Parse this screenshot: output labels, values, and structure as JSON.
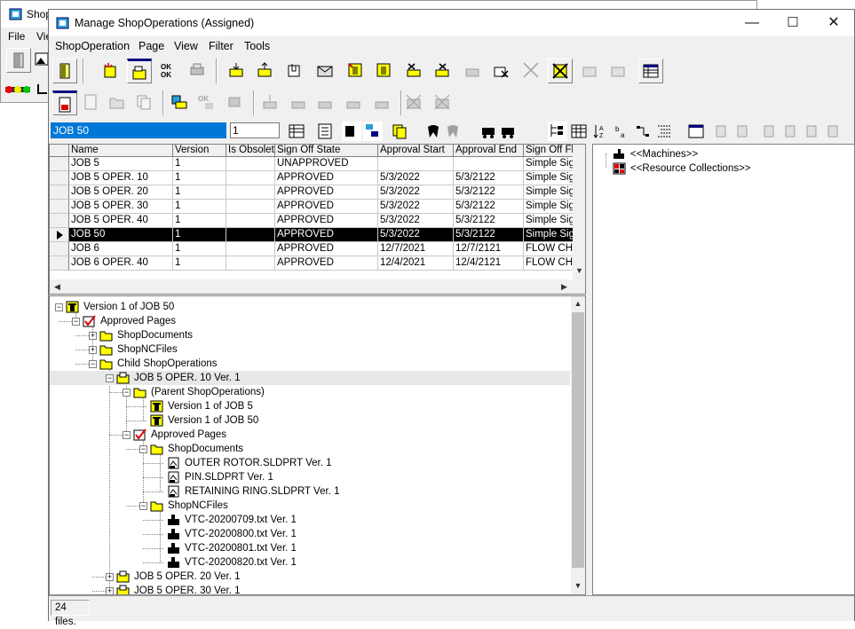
{
  "bg_window": {
    "title": "Shop",
    "menu": [
      "File",
      "Vie"
    ]
  },
  "window": {
    "title": "Manage ShopOperations (Assigned)",
    "minimize": "—",
    "maximize": "☐",
    "close": "✕"
  },
  "menu": [
    "ShopOperation",
    "Page",
    "View",
    "Filter",
    "Tools"
  ],
  "search": {
    "name_value": "JOB 50",
    "version_value": "1"
  },
  "grid": {
    "columns": [
      "Name",
      "Version",
      "Is Obsolete",
      "Sign Off State",
      "Approval Start",
      "Approval End",
      "Sign Off Flo"
    ],
    "rows": [
      [
        "JOB 5",
        "1",
        "",
        "UNAPPROVED",
        "",
        "",
        "Simple Sign"
      ],
      [
        "JOB 5 OPER. 10",
        "1",
        "",
        "APPROVED",
        "5/3/2022",
        "5/3/2122",
        "Simple Sign"
      ],
      [
        "JOB 5 OPER. 20",
        "1",
        "",
        "APPROVED",
        "5/3/2022",
        "5/3/2122",
        "Simple Sign"
      ],
      [
        "JOB 5 OPER. 30",
        "1",
        "",
        "APPROVED",
        "5/3/2022",
        "5/3/2122",
        "Simple Sign"
      ],
      [
        "JOB 5 OPER. 40",
        "1",
        "",
        "APPROVED",
        "5/3/2022",
        "5/3/2122",
        "Simple Sign"
      ],
      [
        "JOB 50",
        "1",
        "",
        "APPROVED",
        "5/3/2022",
        "5/3/2122",
        "Simple Sign"
      ],
      [
        "JOB 6",
        "1",
        "",
        "APPROVED",
        "12/7/2021",
        "12/7/2121",
        "FLOW CHA"
      ],
      [
        "JOB 6 OPER. 40",
        "1",
        "",
        "APPROVED",
        "12/4/2021",
        "12/4/2121",
        "FLOW CHA"
      ]
    ],
    "selected_row": 5
  },
  "tree": [
    {
      "label": "Version 1 of JOB 50",
      "level": 0,
      "icon": "job-icon",
      "expander": "−"
    },
    {
      "label": "Approved Pages",
      "level": 1,
      "icon": "check-icon",
      "expander": "−"
    },
    {
      "label": "ShopDocuments",
      "level": 2,
      "icon": "folder-icon",
      "expander": "+"
    },
    {
      "label": "ShopNCFiles",
      "level": 2,
      "icon": "folder-icon",
      "expander": "+"
    },
    {
      "label": "Child ShopOperations",
      "level": 2,
      "icon": "folder-icon",
      "expander": "−"
    },
    {
      "label": "JOB 5 OPER. 10 Ver. 1",
      "level": 3,
      "icon": "operation-icon",
      "expander": "−",
      "highlight": true
    },
    {
      "label": "(Parent ShopOperations)",
      "level": 4,
      "icon": "folder-icon",
      "expander": "−"
    },
    {
      "label": "Version 1 of JOB 5",
      "level": 5,
      "icon": "job-icon",
      "expander": ""
    },
    {
      "label": "Version 1 of JOB 50",
      "level": 5,
      "icon": "job-icon",
      "expander": ""
    },
    {
      "label": "Approved Pages",
      "level": 4,
      "icon": "check-icon",
      "expander": "−"
    },
    {
      "label": "ShopDocuments",
      "level": 5,
      "icon": "folder-icon",
      "expander": "−"
    },
    {
      "label": "OUTER ROTOR.SLDPRT Ver. 1",
      "level": 6,
      "icon": "document-icon",
      "expander": ""
    },
    {
      "label": "PIN.SLDPRT Ver. 1",
      "level": 6,
      "icon": "document-icon",
      "expander": ""
    },
    {
      "label": "RETAINING RING.SLDPRT Ver. 1",
      "level": 6,
      "icon": "document-icon",
      "expander": ""
    },
    {
      "label": "ShopNCFiles",
      "level": 5,
      "icon": "folder-icon",
      "expander": "−"
    },
    {
      "label": "VTC-20200709.txt Ver. 1",
      "level": 6,
      "icon": "ncfile-icon",
      "expander": ""
    },
    {
      "label": "VTC-20200800.txt Ver. 1",
      "level": 6,
      "icon": "ncfile-icon",
      "expander": ""
    },
    {
      "label": "VTC-20200801.txt Ver. 1",
      "level": 6,
      "icon": "ncfile-icon",
      "expander": ""
    },
    {
      "label": "VTC-20200820.txt Ver. 1",
      "level": 6,
      "icon": "ncfile-icon",
      "expander": ""
    },
    {
      "label": "JOB 5 OPER. 20 Ver. 1",
      "level": 3,
      "icon": "operation-icon",
      "expander": "+"
    },
    {
      "label": "JOB 5 OPER. 30 Ver. 1",
      "level": 3,
      "icon": "operation-icon",
      "expander": "+"
    }
  ],
  "right_tree": [
    {
      "label": "<<Machines>>",
      "icon": "machine-icon"
    },
    {
      "label": "<<Resource Collections>>",
      "icon": "resource-collection-icon"
    }
  ],
  "status": {
    "text": "24 files."
  },
  "colors": {
    "folder": "#ffff00",
    "check": "#e00000",
    "selected_row_bg": "#000000",
    "window_bg": "#f0f0f0"
  }
}
